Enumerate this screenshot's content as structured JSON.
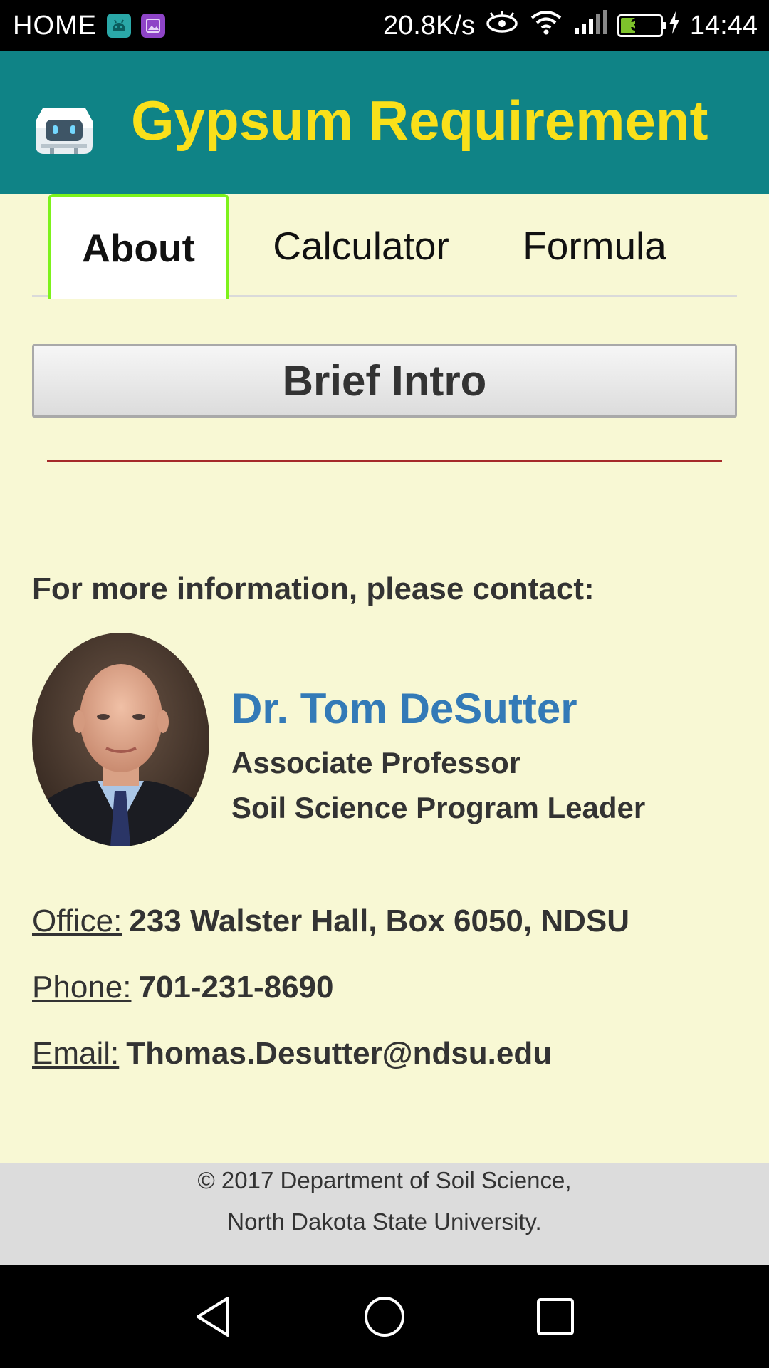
{
  "status_bar": {
    "carrier": "HOME",
    "speed": "20.8K/s",
    "battery": "35",
    "time": "14:44"
  },
  "header": {
    "title": "Gypsum Requirement",
    "logo_icon": "robot-app-icon"
  },
  "tabs": [
    {
      "label": "About",
      "active": true
    },
    {
      "label": "Calculator",
      "active": false
    },
    {
      "label": "Formula",
      "active": false
    }
  ],
  "intro_button": "Brief Intro",
  "contact": {
    "heading": "For more information, please contact:",
    "name": "Dr. Tom DeSutter",
    "role1": "Associate Professor",
    "role2": "Soil Science Program Leader",
    "office_label": "Office:",
    "office_value": "233 Walster Hall, Box 6050, NDSU",
    "phone_label": "Phone:",
    "phone_value": "701-231-8690",
    "email_label": "Email:",
    "email_value": "Thomas.Desutter@ndsu.edu"
  },
  "footer": {
    "line1": "© 2017 Department of Soil Science,",
    "line2": "North Dakota State University."
  },
  "colors": {
    "header_bg": "#0f8386",
    "title": "#f9e01a",
    "content_bg": "#f8f8d4",
    "name": "#337ab7",
    "tab_active_border": "#7df21b",
    "rule": "#a52a2a"
  }
}
